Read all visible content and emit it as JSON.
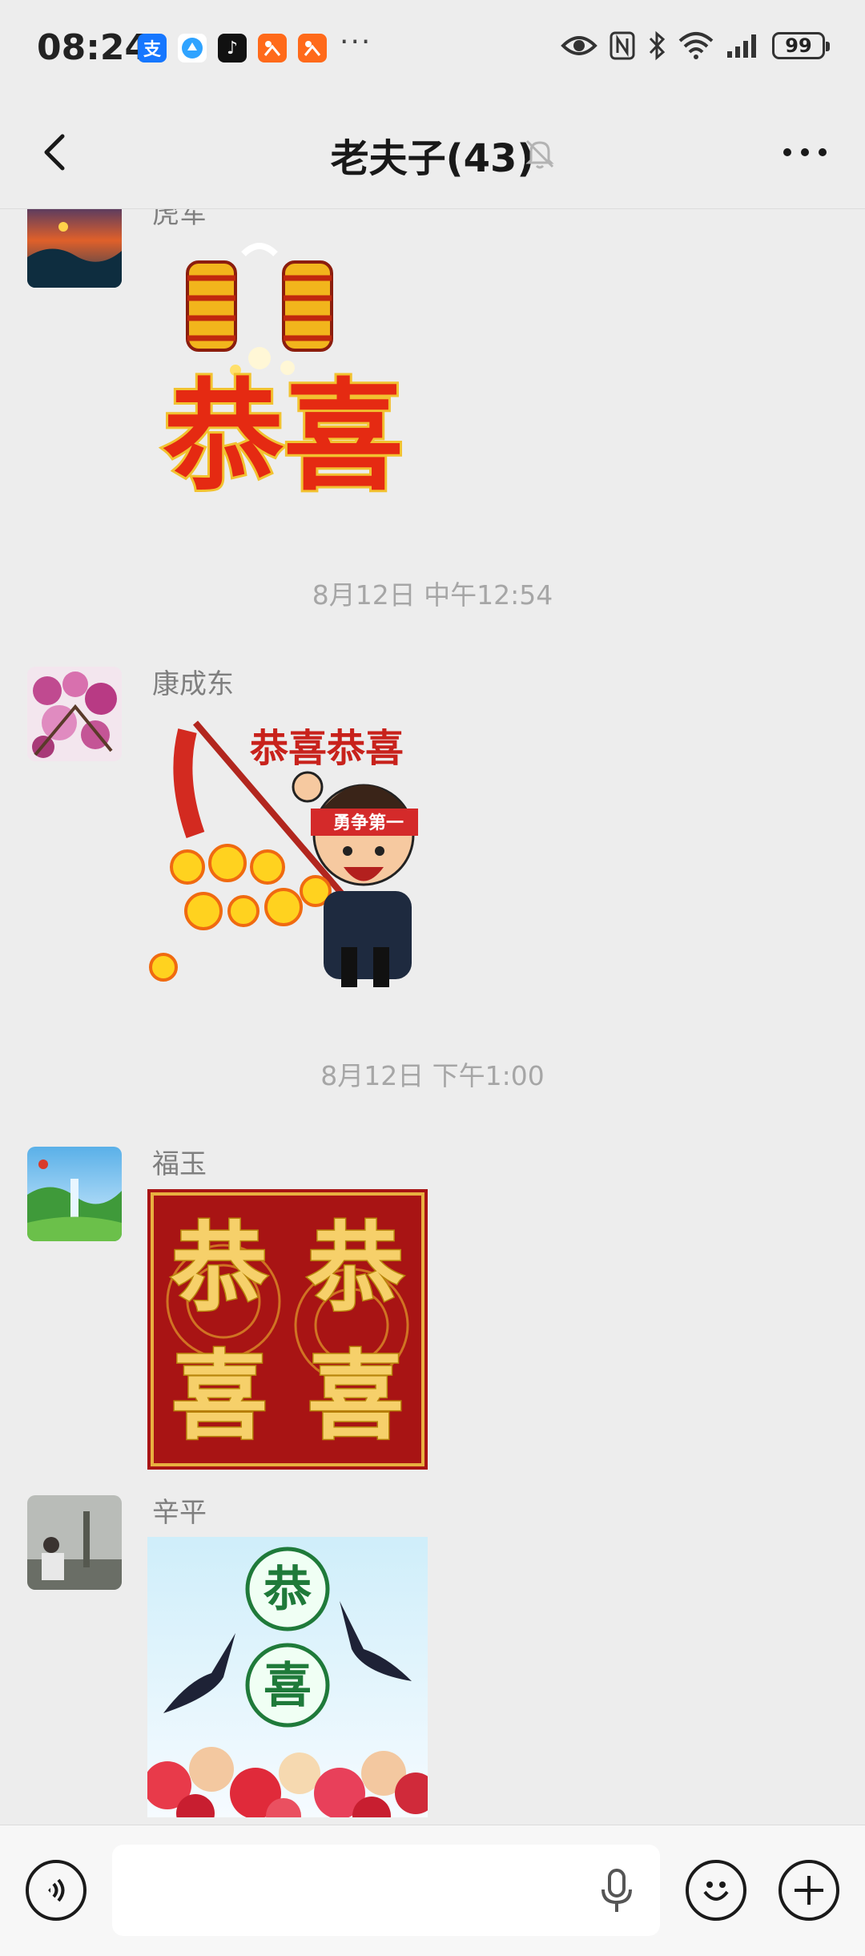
{
  "status_bar": {
    "time": "08:24",
    "app_icons": [
      {
        "name": "alipay-icon",
        "glyph": "支",
        "color": "#1677ff"
      },
      {
        "name": "browser-icon",
        "glyph": "●",
        "color": "#2fa3ff"
      },
      {
        "name": "tiktok-icon",
        "glyph": "♪",
        "color": "#111111"
      },
      {
        "name": "taobao-icon",
        "glyph": "✕",
        "color": "#ff6a1a"
      },
      {
        "name": "taobao-icon-2",
        "glyph": "✕",
        "color": "#ff6a1a"
      }
    ],
    "more": "···",
    "battery": "99"
  },
  "nav": {
    "title": "老夫子(43)"
  },
  "messages": [
    {
      "sender": "虎军",
      "sticker_text": "恭喜"
    },
    {
      "timestamp": "8月12日 中午12:54"
    },
    {
      "sender": "康成东",
      "sticker_text": "恭喜恭喜",
      "headband": "勇争第一"
    },
    {
      "timestamp": "8月12日 下午1:00"
    },
    {
      "sender": "福玉",
      "sticker_text": [
        "恭",
        "恭",
        "喜",
        "喜"
      ]
    },
    {
      "sender": "辛平",
      "sticker_text": [
        "恭",
        "喜"
      ]
    }
  ],
  "colors": {
    "background": "#ededed",
    "festive_red": "#d81e1e",
    "gold": "#f2c230"
  }
}
